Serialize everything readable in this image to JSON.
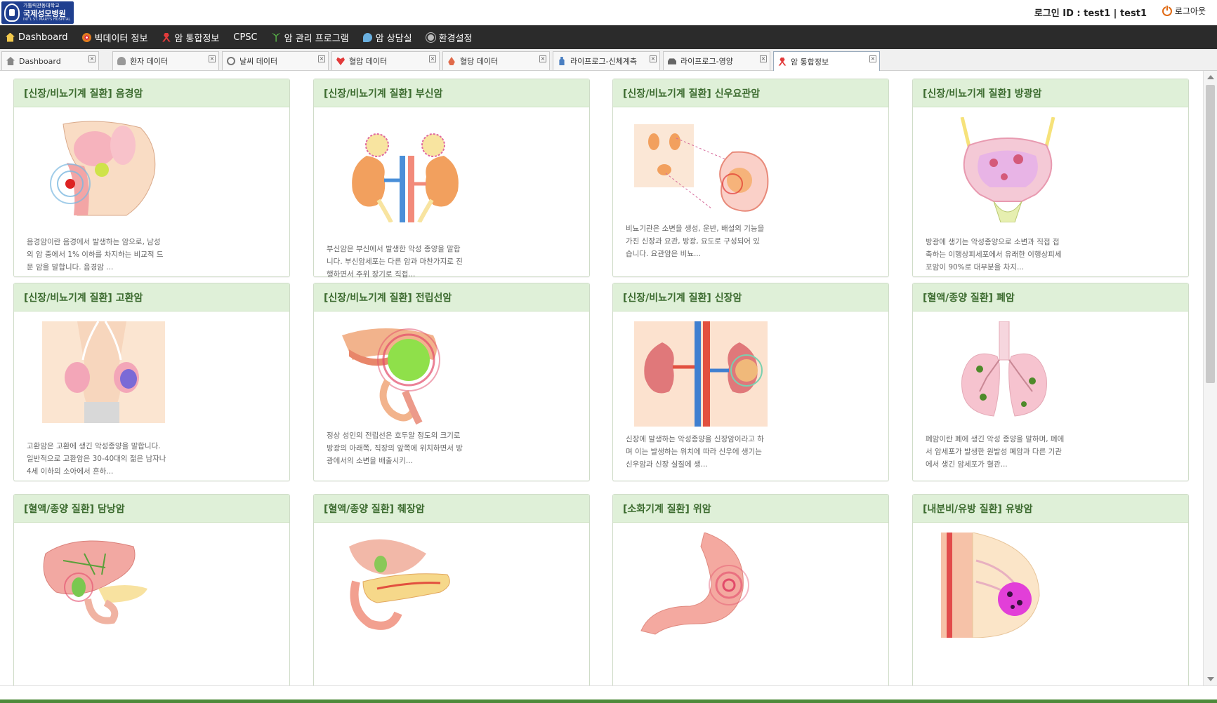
{
  "header": {
    "logo": {
      "line1": "가톨릭관동대학교",
      "line2": "국제성모병원",
      "line3": "INT'L ST. MARY'S HOSPITAL"
    },
    "login_info": "로그인 ID : test1 | test1",
    "logout_label": "로그아웃",
    "logout_icon": "power-icon"
  },
  "menu": [
    {
      "label": "Dashboard",
      "icon": "home-icon"
    },
    {
      "label": "빅데이터 정보",
      "icon": "target-icon"
    },
    {
      "label": "암 통합정보",
      "icon": "ribbon-icon"
    },
    {
      "label": "CPSC",
      "icon": ""
    },
    {
      "label": "암 관리 프로그램",
      "icon": "sprout-icon"
    },
    {
      "label": "암 상담실",
      "icon": "chat-icon"
    },
    {
      "label": "환경설정",
      "icon": "gear-icon"
    }
  ],
  "tabs": [
    {
      "label": "Dashboard",
      "icon": "home-icon",
      "active": false
    },
    {
      "label": "환자 데이터",
      "icon": "person-icon",
      "active": false
    },
    {
      "label": "날씨 데이터",
      "icon": "sun-icon",
      "active": false
    },
    {
      "label": "혈압 데이터",
      "icon": "heart-icon",
      "active": false
    },
    {
      "label": "혈당 데이터",
      "icon": "drop-icon",
      "active": false
    },
    {
      "label": "라이프로그-신체계측",
      "icon": "bottle-icon",
      "active": false
    },
    {
      "label": "라이프로그-영양",
      "icon": "car-icon",
      "active": false
    },
    {
      "label": "암 통합정보",
      "icon": "ribbon-icon",
      "active": true
    }
  ],
  "cards": [
    {
      "title": "[신장/비뇨기계 질환] 음경암",
      "desc": "음경암이란 음경에서 발생하는 암으로, 남성의 암 중에서 1% 이하를 차지하는 비교적 드문 암을 말합니다. 음경암 ..."
    },
    {
      "title": "[신장/비뇨기계 질환] 부신암",
      "desc": "부신암은 부신에서 발생한 악성 종양을 말합니다. 부신암세포는 다른 암과 마찬가지로 진행하면서 주위 장기로 직접..."
    },
    {
      "title": "[신장/비뇨기계 질환] 신우요관암",
      "desc": "비뇨기관은 소변을 생성, 운반, 배설의 기능을 가진 신장과 요관, 방광, 요도로 구성되어 있습니다. 요관암은 비뇨..."
    },
    {
      "title": "[신장/비뇨기계 질환] 방광암",
      "desc": "방광에 생기는 악성종양으로 소변과 직접 접촉하는 이행상피세포에서 유래한 이행상피세포암이 90%로 대부분을 차지..."
    },
    {
      "title": "[신장/비뇨기계 질환] 고환암",
      "desc": "고환암은 고환에 생긴 악성종양을 말합니다. 일반적으로 고환암은 30-40대의 젊은 남자나 4세 이하의 소아에서 흔하..."
    },
    {
      "title": "[신장/비뇨기계 질환] 전립선암",
      "desc": "정상 성인의 전립선은 호두알 정도의 크기로 방광의 아래쪽, 직장의 앞쪽에 위치하면서 방광에서의 소변을 배출시키..."
    },
    {
      "title": "[신장/비뇨기계 질환] 신장암",
      "desc": "신장에 발생하는 악성종양을 신장암이라고 하며 이는 발생하는 위치에 따라 신우에 생기는 신우암과 신장 실질에 생..."
    },
    {
      "title": "[혈액/종양 질환] 폐암",
      "desc": "폐암이란 폐에 생긴 악성 종양을 말하며, 폐에서 암세포가 발생한 원발성 폐암과 다른 기관에서 생긴 암세포가 혈관..."
    },
    {
      "title": "[혈액/종양 질환] 담낭암",
      "desc": ""
    },
    {
      "title": "[혈액/종양 질환] 췌장암",
      "desc": ""
    },
    {
      "title": "[소화기계 질환] 위암",
      "desc": ""
    },
    {
      "title": "[내분비/유방 질환] 유방암",
      "desc": ""
    }
  ],
  "colors": {
    "menubar": "#2b2b2b",
    "card_header": "#dff0d8",
    "card_title": "#3c6b2f",
    "footer_bar": "#4e8a3a"
  }
}
